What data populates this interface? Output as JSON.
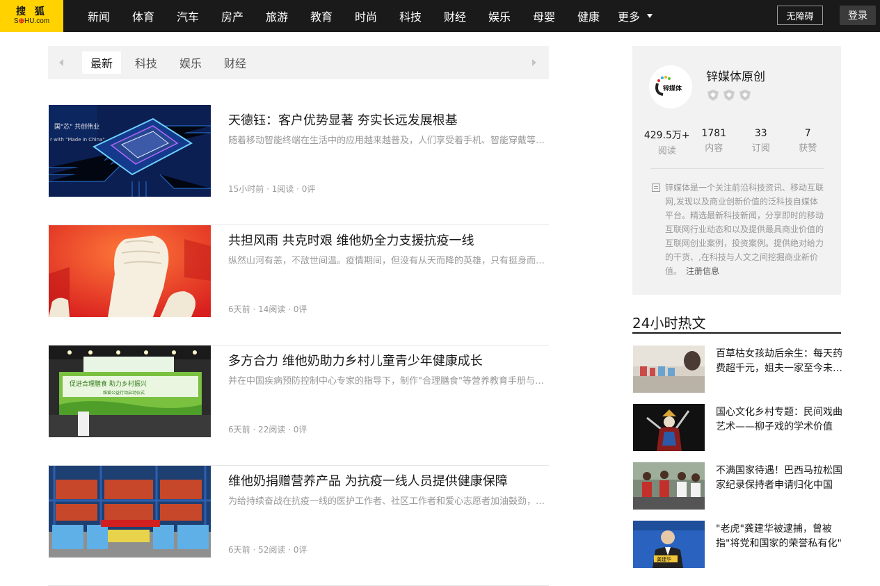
{
  "header": {
    "logo_cn": "搜 狐",
    "logo_en_a": "S",
    "logo_en_b": "⊕",
    "logo_en_c": "HU.com",
    "nav": [
      "新闻",
      "体育",
      "汽车",
      "房产",
      "旅游",
      "教育",
      "时尚",
      "科技",
      "财经",
      "娱乐",
      "母婴",
      "健康"
    ],
    "more_label": "更多",
    "accessibility_label": "无障碍",
    "login_label": "登录"
  },
  "tabs": {
    "items": [
      "最新",
      "科技",
      "娱乐",
      "财经"
    ],
    "active": "最新"
  },
  "articles": [
    {
      "title": "天德钰：客户优势显著 夯实长远发展根基",
      "desc": "随着移动智能终端在生活中的应用越来越普及，人们享受着手机、智能穿戴等设备带来的便利",
      "meta": "15小时前 · 1阅读 · 0评",
      "thumb_text_1": "国\"芯\" 共创伟业",
      "thumb_text_2": "r with \"Made in China\""
    },
    {
      "title": "共担风雨 共克时艰 维他奶全力支援抗疫一线",
      "desc": "纵然山河有恙，不敌世间温。疫情期间，但没有从天而降的英雄，只有挺身而出的凡人",
      "meta": "6天前 · 14阅读 · 0评"
    },
    {
      "title": "多方合力 维他奶助力乡村儿童青少年健康成长",
      "desc": "并在中国疾病预防控制中心专家的指导下，制作\"合理膳食\"等营养教育手册与课程",
      "meta": "6天前 · 22阅读 · 0评",
      "thumb_text_1": "促进合理膳食 助力乡村振兴",
      "thumb_text_2": "维爱公益行动启动仪式"
    },
    {
      "title": "维他奶捐赠营养产品 为抗疫一线人员提供健康保障",
      "desc": "为给持续奋战在抗疫一线的医护工作者、社区工作者和爱心志愿者加油鼓劲，维他奶捐赠产品",
      "meta": "6天前 · 52阅读 · 0评"
    }
  ],
  "author": {
    "name": "锌媒体原创",
    "avatar_text": "锌媒体",
    "stats": [
      {
        "num": "429.5万+",
        "label": "阅读"
      },
      {
        "num": "1781",
        "label": "内容"
      },
      {
        "num": "33",
        "label": "订阅"
      },
      {
        "num": "7",
        "label": "获赞"
      }
    ],
    "intro": "锌媒体是一个关注前沿科技资讯、移动互联网,发现以及商业创新价值的泛科技自媒体平台。精选最新科技新闻，分享即时的移动互联网行业动态和以及提供最具商业价值的互联网创业案例，投资案例。提供绝对给力的干货、,在科技与人文之间挖掘商业新价值。",
    "register_label": "注册信息"
  },
  "hot": {
    "title": "24小时热文",
    "items": [
      {
        "text": "百草枯女孩劫后余生：每天药费超千元，姐夫一家至今未露面"
      },
      {
        "text": "国心文化乡村专题：民间戏曲艺术——柳子戏的学术价值"
      },
      {
        "text": "不满国家待遇！巴西马拉松国家纪录保持者申请归化中国"
      },
      {
        "text": "\"老虎\"龚建华被逮捕，曾被指\"将党和国家的荣誉私有化\"",
        "caption": "龚建华"
      }
    ]
  }
}
